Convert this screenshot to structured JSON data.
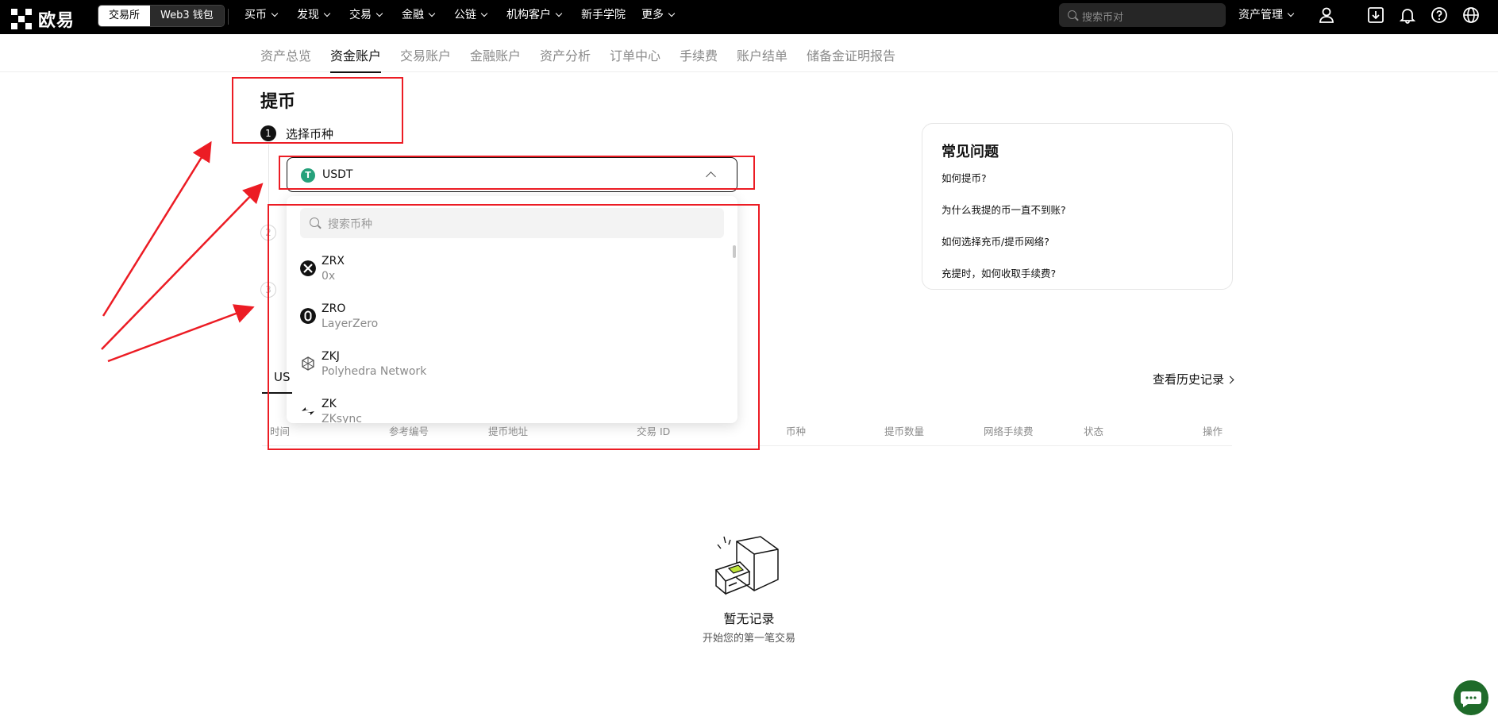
{
  "brand": {
    "name": "欧易"
  },
  "header": {
    "segment": {
      "exchange": "交易所",
      "wallet": "Web3 钱包"
    },
    "nav": [
      "买币",
      "发现",
      "交易",
      "金融",
      "公链",
      "机构客户",
      "新手学院",
      "更多"
    ],
    "search_placeholder": "搜索币对",
    "asset_management": "资产管理"
  },
  "subnav": {
    "tabs": [
      "资产总览",
      "资金账户",
      "交易账户",
      "金融账户",
      "资产分析",
      "订单中心",
      "手续费",
      "账户结单",
      "储备金证明报告"
    ],
    "active": "资金账户"
  },
  "withdraw": {
    "title": "提币",
    "step1": {
      "num": "1",
      "label": "选择币种"
    },
    "step2": {
      "num": "2"
    },
    "step3": {
      "num": "3"
    },
    "selected_coin": "USDT",
    "selected_coin_icon": "tether-icon",
    "dropdown": {
      "search_placeholder": "搜索币种",
      "coins": [
        {
          "symbol": "ZRX",
          "name": "0x"
        },
        {
          "symbol": "ZRO",
          "name": "LayerZero"
        },
        {
          "symbol": "ZKJ",
          "name": "Polyhedra Network"
        },
        {
          "symbol": "ZK",
          "name": "ZKsync"
        }
      ]
    }
  },
  "history": {
    "tab": "USDT",
    "tab_visible": "US",
    "view_history": "查看历史记录",
    "columns": [
      "时间",
      "参考编号",
      "提币地址",
      "交易 ID",
      "币种",
      "提币数量",
      "网络手续费",
      "状态",
      "操作"
    ],
    "empty_title": "暂无记录",
    "empty_subtitle": "开始您的第一笔交易"
  },
  "faq": {
    "title": "常见问题",
    "questions": [
      "如何提币?",
      "为什么我提的币一直不到账?",
      "如何选择充币/提币网络?",
      "充提时，如何收取手续费?"
    ]
  },
  "colors": {
    "accent": "#121212",
    "tether": "#26a17b",
    "annotation": "#ec1c24",
    "chat": "#1f6b2a"
  }
}
